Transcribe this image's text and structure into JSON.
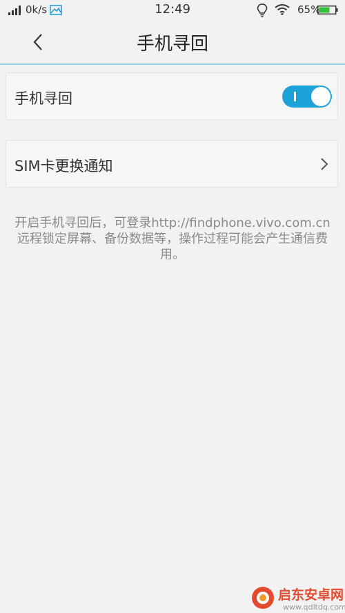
{
  "status_bar": {
    "net_speed": "0k/s",
    "time": "12:49",
    "battery": "65%",
    "icons": [
      "signal-icon",
      "image-icon",
      "bulb-icon",
      "wifi-icon",
      "battery-icon"
    ]
  },
  "header": {
    "title": "手机寻回",
    "back_icon": "chevron-left-icon"
  },
  "settings": {
    "find_phone": {
      "label": "手机寻回",
      "enabled": true
    },
    "sim_notify": {
      "label": "SIM卡更换通知",
      "icon": "chevron-right-icon"
    }
  },
  "note": {
    "text": "开启手机寻回后，可登录http://findphone.vivo.com.cn远程锁定屏幕、备份数据等，操作过程可能会产生通信费用。"
  },
  "watermark": {
    "text": "启东安卓网",
    "url": "www.qdltdq.com"
  },
  "colors": {
    "accent": "#1ea3d9",
    "divider": "#8fd3e6",
    "background": "#f2f2f2",
    "watermark": "#e34a2e"
  }
}
